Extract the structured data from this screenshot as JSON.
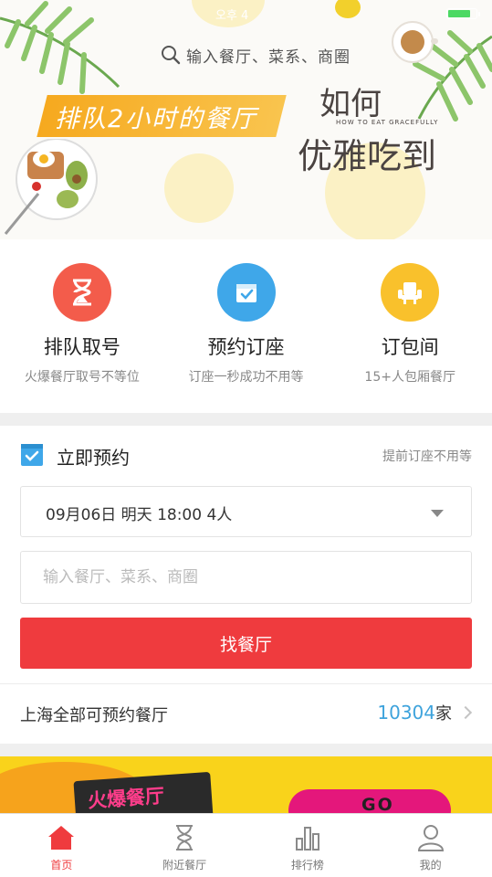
{
  "status_bar": {
    "time": "오후 4"
  },
  "hero": {
    "search_placeholder": "输入餐厅、菜系、商圈",
    "queue_banner": "排队2小时的餐厅",
    "art_title_top": "如何",
    "art_title_sub": "HOW TO EAT GRACEFULLY",
    "art_title_bottom": "优雅吃到"
  },
  "services": [
    {
      "title": "排队取号",
      "subtitle": "火爆餐厅取号不等位",
      "icon": "hourglass-icon",
      "color": "#f35c4b"
    },
    {
      "title": "预约订座",
      "subtitle": "订座一秒成功不用等",
      "icon": "calendar-check-icon",
      "color": "#3fa7e9"
    },
    {
      "title": "订包间",
      "subtitle": "15+人包厢餐厅",
      "icon": "armchair-icon",
      "color": "#f9c12c"
    }
  ],
  "booking": {
    "title": "立即预约",
    "hint": "提前订座不用等",
    "date_value": "09月06日 明天 18:00 4人",
    "search_placeholder": "输入餐厅、菜系、商圈",
    "submit_label": "找餐厅",
    "stats_label": "上海全部可预约餐厅",
    "stats_count": "10304",
    "stats_unit": "家"
  },
  "promo": {
    "sign_text": "火爆餐厅",
    "button_text": "GO"
  },
  "tabs": [
    {
      "label": "首页",
      "icon": "home-icon",
      "active": true
    },
    {
      "label": "附近餐厅",
      "icon": "hourglass-icon",
      "active": false
    },
    {
      "label": "排行榜",
      "icon": "bar-chart-icon",
      "active": false
    },
    {
      "label": "我的",
      "icon": "user-icon",
      "active": false
    }
  ],
  "colors": {
    "accent": "#ef3b3e",
    "link": "#3ea3dc"
  }
}
